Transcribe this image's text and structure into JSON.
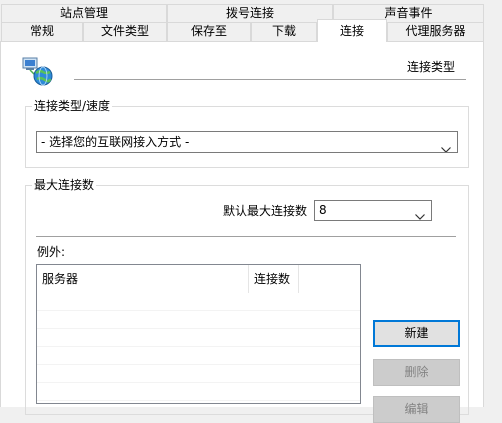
{
  "tabs_back_row": [
    {
      "label": "站点管理"
    },
    {
      "label": "拨号连接"
    },
    {
      "label": "声音事件"
    }
  ],
  "tabs_front_row": [
    {
      "label": "常规"
    },
    {
      "label": "文件类型"
    },
    {
      "label": "保存至"
    },
    {
      "label": "下载"
    },
    {
      "label": "连接"
    },
    {
      "label": "代理服务器"
    }
  ],
  "active_tab": "连接",
  "page": {
    "title": "连接类型",
    "connection_group": {
      "legend": "连接类型/速度",
      "selected_value": "- 选择您的互联网接入方式 -"
    },
    "max_group": {
      "legend": "最大连接数",
      "default_label": "默认最大连接数",
      "default_value": "8",
      "exceptions_label": "例外:",
      "columns": [
        "服务器",
        "连接数"
      ],
      "rows": []
    },
    "buttons": {
      "new": "新建",
      "delete": "删除",
      "edit": "编辑"
    }
  },
  "colors": {
    "accent": "#0078d7",
    "disabled_text": "#838383"
  },
  "icons": {
    "network": "globe-with-computers-icon",
    "dropdown": "chevron-down-icon"
  }
}
